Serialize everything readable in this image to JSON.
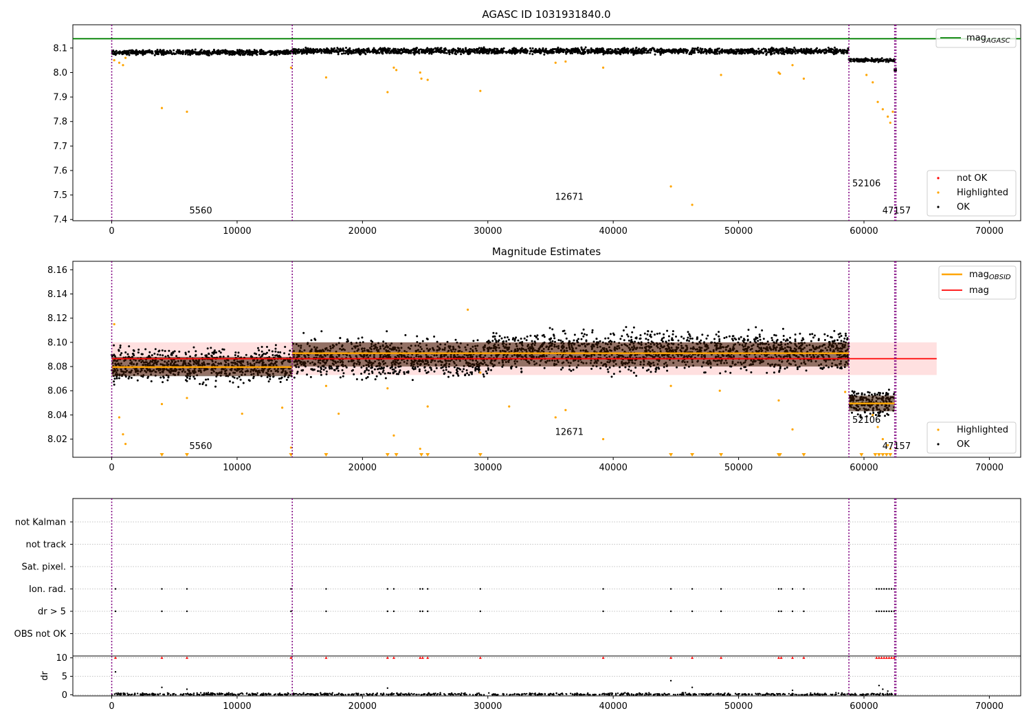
{
  "chart_data": [
    {
      "type": "scatter",
      "title": "AGASC ID 1031931840.0",
      "xlim": [
        -3100,
        72500
      ],
      "ylim": [
        7.395,
        8.195
      ],
      "x_ticks": [
        0,
        10000,
        20000,
        30000,
        40000,
        50000,
        60000,
        70000
      ],
      "x_tick_labels": [
        "0",
        "10000",
        "20000",
        "30000",
        "40000",
        "50000",
        "60000",
        "70000"
      ],
      "y_ticks": [
        7.4,
        7.5,
        7.6,
        7.7,
        7.8,
        7.9,
        8.0,
        8.1
      ],
      "y_tick_labels": [
        "7.4",
        "7.5",
        "7.6",
        "7.7",
        "7.8",
        "7.9",
        "8.0",
        "8.1"
      ],
      "mag_agasc": 8.138,
      "obsid_boundaries": [
        0,
        14400,
        58800,
        62450,
        62550
      ],
      "obsid_labels": [
        {
          "text": "5560",
          "x": 7100,
          "y": 7.425
        },
        {
          "text": "12671",
          "x": 36500,
          "y": 7.48
        },
        {
          "text": "52106",
          "x": 60200,
          "y": 7.535
        },
        {
          "text": "47157",
          "x": 62600,
          "y": 7.425
        }
      ],
      "series": [
        {
          "name": "not OK",
          "color": "#ff0000"
        },
        {
          "name": "Highlighted",
          "color": "#ffa500",
          "points": [
            [
              200,
              8.05
            ],
            [
              600,
              8.04
            ],
            [
              900,
              8.03
            ],
            [
              1100,
              8.06
            ],
            [
              4000,
              7.855
            ],
            [
              6000,
              7.84
            ],
            [
              14300,
              8.02
            ],
            [
              17100,
              7.98
            ],
            [
              22000,
              7.92
            ],
            [
              22500,
              8.02
            ],
            [
              22700,
              8.01
            ],
            [
              24600,
              8.0
            ],
            [
              24700,
              7.975
            ],
            [
              25200,
              7.97
            ],
            [
              29400,
              7.925
            ],
            [
              35400,
              8.04
            ],
            [
              36200,
              8.045
            ],
            [
              39200,
              8.02
            ],
            [
              44600,
              7.535
            ],
            [
              46300,
              7.46
            ],
            [
              48600,
              7.99
            ],
            [
              53200,
              8.0
            ],
            [
              53300,
              7.995
            ],
            [
              54300,
              8.03
            ],
            [
              55200,
              7.975
            ],
            [
              60200,
              7.99
            ],
            [
              60700,
              7.96
            ],
            [
              61100,
              7.88
            ],
            [
              61500,
              7.85
            ],
            [
              61900,
              7.82
            ],
            [
              62100,
              7.795
            ],
            [
              62300,
              7.84
            ]
          ]
        },
        {
          "name": "OK",
          "color": "#000000"
        }
      ],
      "ok_bands": [
        {
          "x0": 0,
          "x1": 14400,
          "ymin": 8.068,
          "ymax": 8.096
        },
        {
          "x0": 14400,
          "x1": 58800,
          "ymin": 8.07,
          "ymax": 8.105
        },
        {
          "x0": 58800,
          "x1": 62450,
          "ymin": 8.04,
          "ymax": 8.06
        },
        {
          "x0": 62450,
          "x1": 62550,
          "ymin": 8.0,
          "ymax": 8.02
        }
      ],
      "legend_agasc": {
        "label": "mag",
        "subscript": "AGASC",
        "color": "#008000",
        "position": "top-right"
      },
      "legend_points": {
        "position": "lower-right"
      }
    },
    {
      "type": "scatter",
      "title": "Magnitude Estimates",
      "xlim": [
        -3100,
        72500
      ],
      "ylim": [
        8.005,
        8.167
      ],
      "x_ticks": [
        0,
        10000,
        20000,
        30000,
        40000,
        50000,
        60000,
        70000
      ],
      "x_tick_labels": [
        "0",
        "10000",
        "20000",
        "30000",
        "40000",
        "50000",
        "60000",
        "70000"
      ],
      "y_ticks": [
        8.02,
        8.04,
        8.06,
        8.08,
        8.1,
        8.12,
        8.14,
        8.16
      ],
      "y_tick_labels": [
        "8.02",
        "8.04",
        "8.06",
        "8.08",
        "8.10",
        "8.12",
        "8.14",
        "8.16"
      ],
      "mag": 8.0865,
      "mag_band": [
        8.073,
        8.1
      ],
      "mag_band_xrange": [
        0,
        65800
      ],
      "mag_obsid": [
        {
          "x0": 0,
          "x1": 14400,
          "mag": 8.0795,
          "band": [
            8.072,
            8.088
          ]
        },
        {
          "x0": 14400,
          "x1": 58800,
          "mag": 8.091,
          "band": [
            8.08,
            8.1
          ]
        },
        {
          "x0": 58800,
          "x1": 62450,
          "mag": 8.0495,
          "band": [
            8.043,
            8.056
          ]
        }
      ],
      "obsid_boundaries": [
        0,
        14400,
        58800,
        62450,
        62550
      ],
      "obsid_labels": [
        {
          "text": "5560",
          "x": 7100,
          "y": 8.0118
        },
        {
          "text": "12671",
          "x": 36500,
          "y": 8.0235
        },
        {
          "text": "52106",
          "x": 60200,
          "y": 8.0335
        },
        {
          "text": "47157",
          "x": 62600,
          "y": 8.0118
        }
      ],
      "series": [
        {
          "name": "Highlighted",
          "color": "#ffa500",
          "points": [
            [
              200,
              8.115
            ],
            [
              600,
              8.038
            ],
            [
              900,
              8.024
            ],
            [
              1100,
              8.016
            ],
            [
              4000,
              8.049
            ],
            [
              6000,
              8.054
            ],
            [
              10400,
              8.041
            ],
            [
              13600,
              8.046
            ],
            [
              14300,
              8.013
            ],
            [
              17100,
              8.064
            ],
            [
              18100,
              8.041
            ],
            [
              22000,
              8.062
            ],
            [
              22500,
              8.023
            ],
            [
              24600,
              8.012
            ],
            [
              25200,
              8.047
            ],
            [
              28400,
              8.127
            ],
            [
              29400,
              8.075
            ],
            [
              31700,
              8.047
            ],
            [
              35400,
              8.038
            ],
            [
              36200,
              8.044
            ],
            [
              39200,
              8.02
            ],
            [
              44600,
              8.064
            ],
            [
              48500,
              8.06
            ],
            [
              53200,
              8.052
            ],
            [
              54300,
              8.028
            ],
            [
              58500,
              8.059
            ],
            [
              60700,
              8.04
            ],
            [
              61100,
              8.03
            ],
            [
              61500,
              8.02
            ],
            [
              61900,
              8.015
            ],
            [
              62100,
              8.012
            ]
          ]
        },
        {
          "name": "OK",
          "color": "#000000"
        }
      ],
      "ok_bands": [
        {
          "x0": 0,
          "x1": 14400,
          "ymin": 8.062,
          "ymax": 8.1
        },
        {
          "x0": 14400,
          "x1": 30000,
          "ymin": 8.065,
          "ymax": 8.11
        },
        {
          "x0": 30000,
          "x1": 58800,
          "ymin": 8.07,
          "ymax": 8.115
        },
        {
          "x0": 58800,
          "x1": 62450,
          "ymin": 8.035,
          "ymax": 8.065
        }
      ],
      "lower_limit_markers_x": [
        4000,
        6000,
        14300,
        17100,
        22000,
        22700,
        24700,
        25200,
        29400,
        44600,
        46300,
        48600,
        53200,
        53300,
        55200,
        59800,
        60900,
        61200,
        61500,
        61800,
        62100
      ],
      "legend_mag": [
        {
          "label": "mag",
          "subscript": "OBSID",
          "color": "#ffa500"
        },
        {
          "label": "mag",
          "subscript": "",
          "color": "#ff0000"
        }
      ],
      "legend_points": {
        "position": "lower-right"
      }
    },
    {
      "type": "scatter",
      "title": "",
      "xlim": [
        -3100,
        72500
      ],
      "categories": [
        "not Kalman",
        "not track",
        "Sat. pixel.",
        "Ion. rad.",
        "dr > 5",
        "OBS not OK"
      ],
      "flag_points_x": [
        300,
        4000,
        6000,
        14300,
        17100,
        22000,
        22500,
        24600,
        24800,
        25200,
        29400,
        39200,
        44600,
        46300,
        48600,
        53200,
        53400,
        54300,
        55200,
        61000,
        61200,
        61400,
        61600,
        61800,
        62000,
        62200,
        62400
      ],
      "flag_rows": [
        "Ion. rad.",
        "dr > 5"
      ],
      "obsid_boundaries": [
        0,
        14400,
        58800,
        62450,
        62550
      ]
    },
    {
      "type": "scatter",
      "title": "",
      "ylabel": "dr",
      "xlim": [
        -3100,
        72500
      ],
      "ylim": [
        -0.3,
        10.5
      ],
      "x_ticks": [
        0,
        10000,
        20000,
        30000,
        40000,
        50000,
        60000,
        70000
      ],
      "x_tick_labels": [
        "0",
        "10000",
        "20000",
        "30000",
        "40000",
        "50000",
        "60000",
        "70000"
      ],
      "y_ticks": [
        0,
        5,
        10
      ],
      "y_tick_labels": [
        "0",
        "5",
        "10"
      ],
      "clipped_marker_x": [
        300,
        4000,
        6000,
        14300,
        17100,
        22000,
        22500,
        24600,
        24800,
        25200,
        29400,
        39200,
        44600,
        46300,
        48600,
        53200,
        53400,
        54300,
        55200,
        61000,
        61200,
        61400,
        61600,
        61800,
        62000,
        62200,
        62400
      ],
      "clipped_value": 10,
      "outliers": [
        [
          300,
          6.2
        ],
        [
          4000,
          2.0
        ],
        [
          6000,
          1.5
        ],
        [
          22000,
          1.8
        ],
        [
          44600,
          3.8
        ],
        [
          46300,
          2.0
        ],
        [
          54300,
          1.2
        ],
        [
          61200,
          2.5
        ],
        [
          61500,
          1.5
        ],
        [
          61900,
          1.0
        ]
      ],
      "base_band": {
        "x0": 0,
        "x1": 62550,
        "ymin": 0,
        "ymax": 0.6
      },
      "obsid_boundaries": [
        0,
        14400,
        58800,
        62450,
        62550
      ]
    }
  ]
}
